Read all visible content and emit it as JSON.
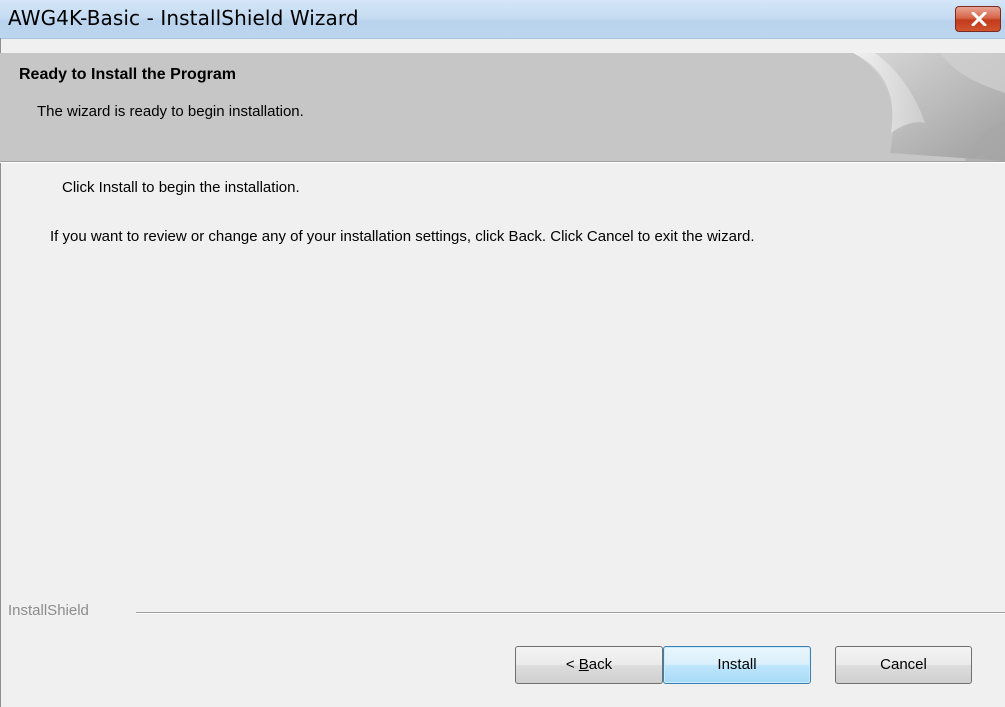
{
  "window": {
    "title": "AWG4K-Basic - InstallShield Wizard"
  },
  "header": {
    "title": "Ready to Install the Program",
    "subtitle": "The wizard is ready to begin installation."
  },
  "body": {
    "line1": "Click Install to begin the installation.",
    "line2": "If you want to review or change any of your installation settings, click Back. Click Cancel to exit the wizard."
  },
  "footer": {
    "brand": "InstallShield"
  },
  "buttons": {
    "back_prefix": "< ",
    "back_mnemonic": "B",
    "back_rest": "ack",
    "install": "Install",
    "cancel": "Cancel"
  },
  "icons": {
    "close": "close-icon",
    "header_graphic": "page-curl-graphic"
  }
}
